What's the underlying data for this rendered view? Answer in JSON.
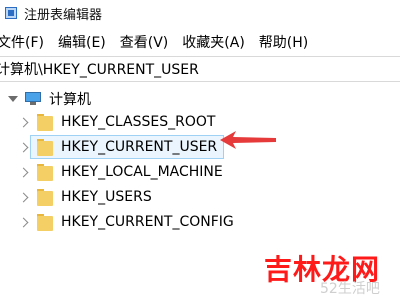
{
  "window": {
    "title": "注册表编辑器",
    "icon": "registry-icon"
  },
  "menu": [
    "文件(F)",
    "编辑(E)",
    "查看(V)",
    "收藏夹(A)",
    "帮助(H)"
  ],
  "address": "计算机\\HKEY_CURRENT_USER",
  "tree": {
    "root": {
      "label": "计算机",
      "icon": "computer-icon"
    },
    "items": [
      {
        "label": "HKEY_CLASSES_ROOT"
      },
      {
        "label": "HKEY_CURRENT_USER"
      },
      {
        "label": "HKEY_LOCAL_MACHINE"
      },
      {
        "label": "HKEY_USERS"
      },
      {
        "label": "HKEY_CURRENT_CONFIG"
      }
    ],
    "selected_index": 1
  },
  "annotation": {
    "arrow_color": "#e5393a"
  },
  "watermark": {
    "brand": "吉林龙网",
    "small": "52生活吧"
  }
}
